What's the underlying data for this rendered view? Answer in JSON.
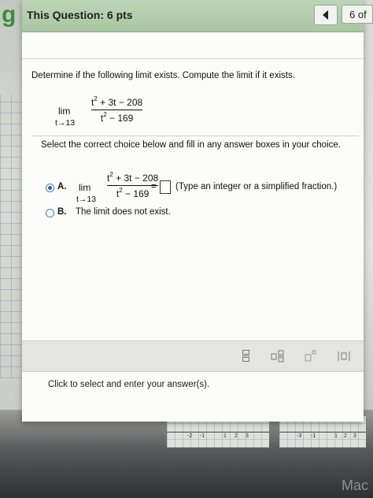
{
  "header": {
    "title": "This Question: 6 pts",
    "page_count": "6 of"
  },
  "question": {
    "prompt": "Determine if the following limit exists. Compute the limit if it exists.",
    "limit": {
      "lim": "lim",
      "approach": "t→13",
      "numerator_pre": "t",
      "numerator_post": " + 3t − 208",
      "denominator_pre": "t",
      "denominator_post": " − 169",
      "exponent": "2"
    },
    "instruction": "Select the correct choice below and fill in any answer boxes in your choice.",
    "options": [
      {
        "letter": "A.",
        "equals": "=",
        "hint": "(Type an integer or a simplified fraction.)",
        "selected": true
      },
      {
        "letter": "B.",
        "text": "The limit does not exist.",
        "selected": false
      }
    ]
  },
  "footer": {
    "text": "Click to select and enter your answer(s)."
  },
  "background": {
    "corner_letter": "g",
    "bottom_right": "Mac",
    "axis_labels": [
      "-2",
      "-1",
      "1",
      "2",
      "3",
      "-3",
      "-1",
      "1",
      "2",
      "3"
    ]
  },
  "colors": {
    "header_green": "#a9c6a3",
    "radio_blue": "#1f5fb8"
  }
}
